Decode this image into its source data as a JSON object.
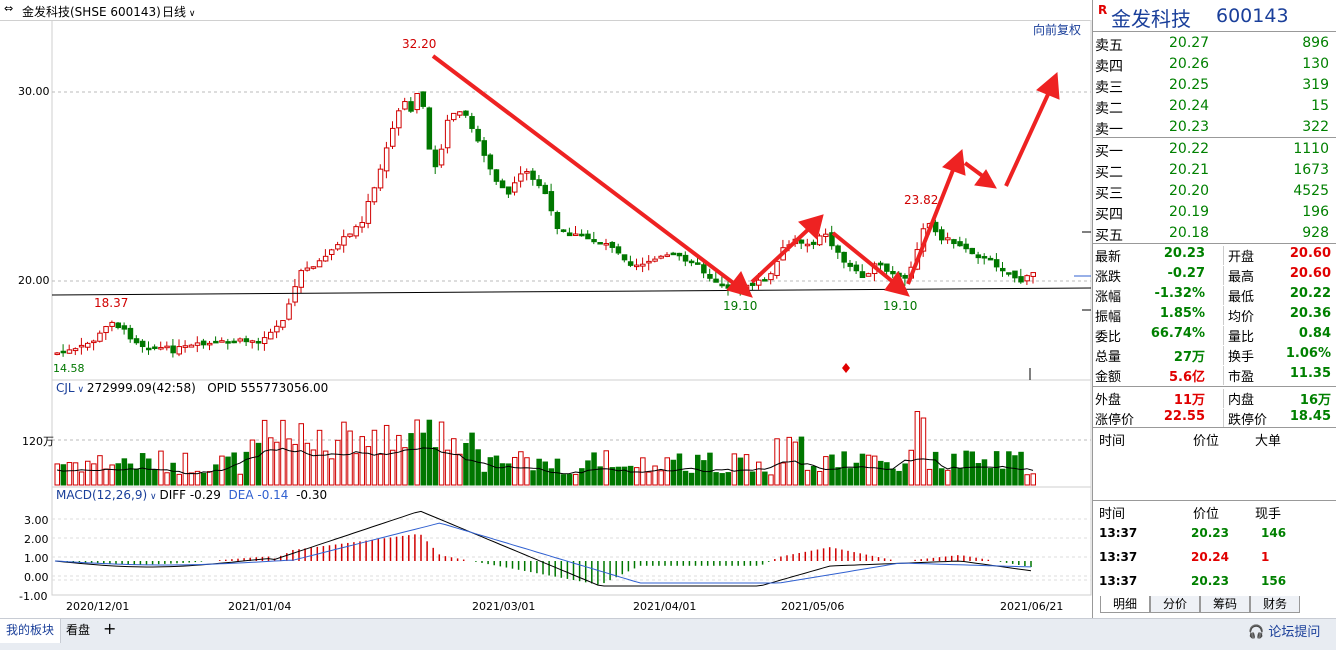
{
  "header": {
    "title": "金发科技(SHSE 600143)",
    "period": "日线",
    "adjust": "向前复权"
  },
  "axis": {
    "price_ticks": [
      "30.00",
      "20.00"
    ],
    "vol_tick": "120万",
    "macd_ticks": [
      "3.00",
      "2.00",
      "1.00",
      "0.00",
      "-1.00"
    ],
    "dates": [
      "2020/12/01",
      "2021/01/04",
      "2021/03/01",
      "2021/04/01",
      "2021/05/06",
      "2021/06/21"
    ]
  },
  "annotations": {
    "high": "32.20",
    "low1": "18.37",
    "low0": "14.58",
    "low2": "19.10",
    "low3": "19.10",
    "peak2": "23.82"
  },
  "cjl": {
    "label": "CJL",
    "value": "272999.09(42:58)",
    "opid": "OPID 555773056.00"
  },
  "macd": {
    "label": "MACD(12,26,9)",
    "diff": "DIFF -0.29",
    "dea": "DEA -0.14",
    "macd": "-0.30"
  },
  "stock": {
    "flag": "R",
    "name": "金发科技",
    "code": "600143"
  },
  "asks": [
    {
      "label": "卖五",
      "price": "20.27",
      "vol": "896"
    },
    {
      "label": "卖四",
      "price": "20.26",
      "vol": "130"
    },
    {
      "label": "卖三",
      "price": "20.25",
      "vol": "319"
    },
    {
      "label": "卖二",
      "price": "20.24",
      "vol": "15"
    },
    {
      "label": "卖一",
      "price": "20.23",
      "vol": "322"
    }
  ],
  "bids": [
    {
      "label": "买一",
      "price": "20.22",
      "vol": "1110"
    },
    {
      "label": "买二",
      "price": "20.21",
      "vol": "1673"
    },
    {
      "label": "买三",
      "price": "20.20",
      "vol": "4525"
    },
    {
      "label": "买四",
      "price": "20.19",
      "vol": "196"
    },
    {
      "label": "买五",
      "price": "20.18",
      "vol": "928"
    }
  ],
  "stats": [
    {
      "l1": "最新",
      "v1": "20.23",
      "c1": "g",
      "l2": "开盘",
      "v2": "20.60",
      "c2": "r"
    },
    {
      "l1": "涨跌",
      "v1": "-0.27",
      "c1": "g",
      "l2": "最高",
      "v2": "20.60",
      "c2": "r"
    },
    {
      "l1": "涨幅",
      "v1": "-1.32%",
      "c1": "g",
      "l2": "最低",
      "v2": "20.22",
      "c2": "g"
    },
    {
      "l1": "振幅",
      "v1": "1.85%",
      "c1": "g",
      "l2": "均价",
      "v2": "20.36",
      "c2": "g"
    },
    {
      "l1": "委比",
      "v1": "66.74%",
      "c1": "g",
      "l2": "量比",
      "v2": "0.84",
      "c2": "g"
    },
    {
      "l1": "总量",
      "v1": "27万",
      "c1": "g",
      "l2": "换手",
      "v2": "1.06%",
      "c2": "g"
    },
    {
      "l1": "金额",
      "v1": "5.6亿",
      "c1": "r",
      "l2": "市盈",
      "v2": "11.35",
      "c2": "g"
    }
  ],
  "stats2": [
    {
      "l1": "外盘",
      "v1": "11万",
      "c1": "r",
      "l2": "内盘",
      "v2": "16万",
      "c2": "g"
    },
    {
      "l1": "涨停价",
      "v1": "22.55",
      "c1": "r",
      "l2": "跌停价",
      "v2": "18.45",
      "c2": "g"
    }
  ],
  "bigorder": {
    "h1": "时间",
    "h2": "价位",
    "h3": "大单"
  },
  "ticks": {
    "h1": "时间",
    "h2": "价位",
    "h3": "现手",
    "rows": [
      {
        "time": "13:37",
        "price": "20.23",
        "vol": "146",
        "c": "g"
      },
      {
        "time": "13:37",
        "price": "20.24",
        "vol": "1",
        "c": "r"
      },
      {
        "time": "13:37",
        "price": "20.23",
        "vol": "156",
        "c": "g"
      }
    ]
  },
  "tabs": [
    "明细",
    "分价",
    "筹码",
    "财务"
  ],
  "bottom": {
    "board": "我的板块",
    "watch": "看盘",
    "add": "+",
    "forum": "论坛提问"
  },
  "colors": {
    "up": "#d00000",
    "down": "#007700",
    "arrow": "#ee2222"
  }
}
